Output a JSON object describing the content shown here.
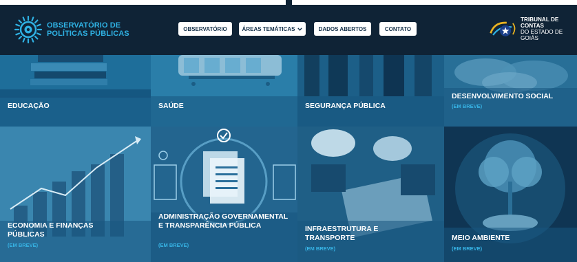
{
  "header": {
    "logo_line1": "OBSERVATÓRIO DE",
    "logo_line2": "POLÍTICAS PÚBLICAS",
    "nav": [
      {
        "label": "OBSERVATÓRIO"
      },
      {
        "label": "ÁREAS TEMÁTICAS",
        "has_dropdown": true
      },
      {
        "label": "DADOS ABERTOS"
      },
      {
        "label": "CONTATO"
      }
    ],
    "partner_line1": "TRIBUNAL DE CONTAS",
    "partner_line2": "DO ESTADO DE GOIÁS"
  },
  "tiles": [
    {
      "label": "EDUCAÇÃO",
      "status": ""
    },
    {
      "label": "SAÚDE",
      "status": ""
    },
    {
      "label": "SEGURANÇA PÚBLICA",
      "status": ""
    },
    {
      "label": "DESENVOLVIMENTO SOCIAL",
      "status": "(EM BREVE)"
    },
    {
      "label": "ECONOMIA E FINANÇAS PÚBLICAS",
      "status": "(EM BREVE)"
    },
    {
      "label": "ADMINISTRAÇÃO GOVERNAMENTAL E TRANSPARÊNCIA PÚBLICA",
      "status": "(EM BREVE)"
    },
    {
      "label": "INFRAESTRUTURA E TRANSPORTE",
      "status": "(EM BREVE)"
    },
    {
      "label": "MEIO AMBIENTE",
      "status": "(EM BREVE)"
    }
  ],
  "colors": {
    "header_bg": "#0f2336",
    "accent": "#2fb2e4",
    "tile_overlay": "#175680"
  },
  "icons": {
    "logo": "eye-sun-logo-icon",
    "dropdown": "chevron-down-icon",
    "partner": "tce-go-logo-icon"
  }
}
